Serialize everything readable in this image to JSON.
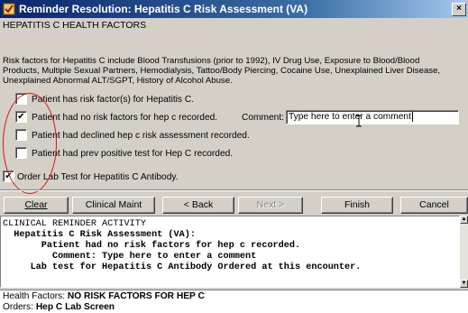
{
  "window": {
    "title": "Reminder Resolution: Hepatitis C Risk Assessment (VA)",
    "close_glyph": "×"
  },
  "section_heading": "HEPATITIS C HEALTH FACTORS",
  "description": "Risk factors for Hepatitis C include Blood Transfusions (prior to 1992), IV Drug Use, Exposure to Blood/Blood Products, Multiple Sexual Partners, Hemodialysis, Tattoo/Body Piercing, Cocaine Use, Unexplained Liver Disease, Unexplained Abnormal ALT/SGPT, History of Alcohol Abuse.",
  "options": [
    {
      "label": "Patient has risk factor(s) for Hepatitis C.",
      "checked": false
    },
    {
      "label": "Patient had no risk factors for hep c recorded.",
      "checked": true
    },
    {
      "label": "Patient had declined hep c risk assessment recorded.",
      "checked": false
    },
    {
      "label": "Patient had prev positive test for Hep C recorded.",
      "checked": false
    }
  ],
  "comment": {
    "label": "Comment:",
    "value": "Type here to enter a comment"
  },
  "order_option": {
    "label": "Order Lab Test for Hepatitis C Antibody.",
    "checked": true
  },
  "check_glyph": "✔",
  "buttons": {
    "clear": "Clear",
    "clinical_maint": "Clinical Maint",
    "back": "< Back",
    "next": "Next >",
    "finish": "Finish",
    "cancel": "Cancel"
  },
  "activity": {
    "lines": [
      "CLINICAL REMINDER ACTIVITY",
      "  Hepatitis C Risk Assessment (VA):",
      "       Patient had no risk factors for hep c recorded.",
      "         Comment: Type here to enter a comment",
      "     Lab test for Hepatitis C Antibody Ordered at this encounter."
    ]
  },
  "summary": {
    "health_factors_label": "Health Factors:",
    "health_factors_value": "NO RISK FACTORS FOR HEP C",
    "orders_label": "Orders:",
    "orders_value": "Hep C Lab Screen"
  },
  "scroll_up_glyph": "▲",
  "scroll_down_glyph": "▼",
  "annotation_color": "#d01818",
  "titlebar_color": "#0a246a"
}
